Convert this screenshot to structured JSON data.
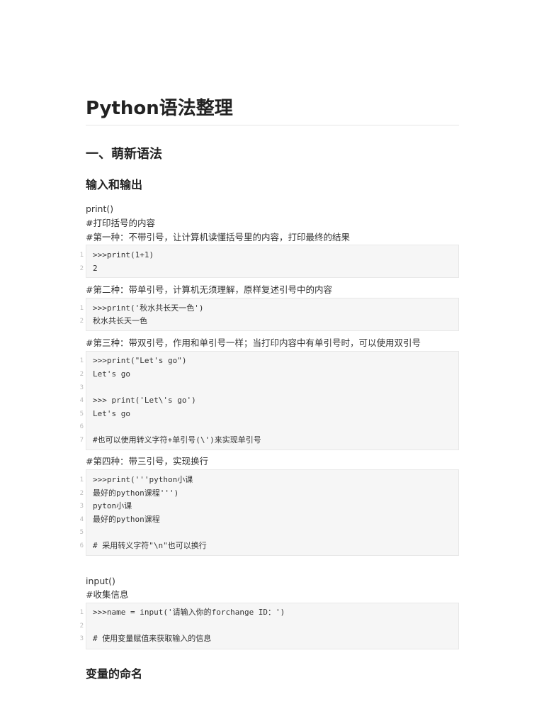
{
  "title": "Python语法整理",
  "section1": "一、萌新语法",
  "sub_io": "输入和输出",
  "print_func": "print()",
  "print_desc": "#打印括号的内容",
  "type1": "#第一种：不带引号，让计算机读懂括号里的内容，打印最终的结果",
  "code1": [
    "1",
    ">>>print(1+1)",
    "2",
    "2"
  ],
  "type2": "#第二种：带单引号，计算机无须理解，原样复述引号中的内容",
  "code2": [
    "1",
    ">>>print('秋水共长天一色')",
    "2",
    "秋水共长天一色"
  ],
  "type3": "#第三种：带双引号，作用和单引号一样；当打印内容中有单引号时，可以使用双引号",
  "code3": [
    "1",
    ">>>print(\"Let's go\")",
    "2",
    "Let's go",
    "3",
    "",
    "4",
    ">>> print('Let\\'s go')",
    "5",
    "Let's go",
    "6",
    "",
    "7",
    "#也可以使用转义字符+单引号(\\')来实现单引号"
  ],
  "type4": "#第四种：带三引号，实现换行",
  "code4": [
    "1",
    ">>>print('''python小课",
    "2",
    "最好的python课程''')",
    "3",
    "pyton小课",
    "4",
    "最好的python课程",
    "5",
    "",
    "6",
    "# 采用转义字符\"\\n\"也可以换行"
  ],
  "input_func": "input()",
  "input_desc": "#收集信息",
  "code5": [
    "1",
    ">>>name = input('请输入你的forchange ID：')",
    "2",
    "",
    "3",
    "# 使用变量赋值来获取输入的信息"
  ],
  "sub_var": "变量的命名"
}
